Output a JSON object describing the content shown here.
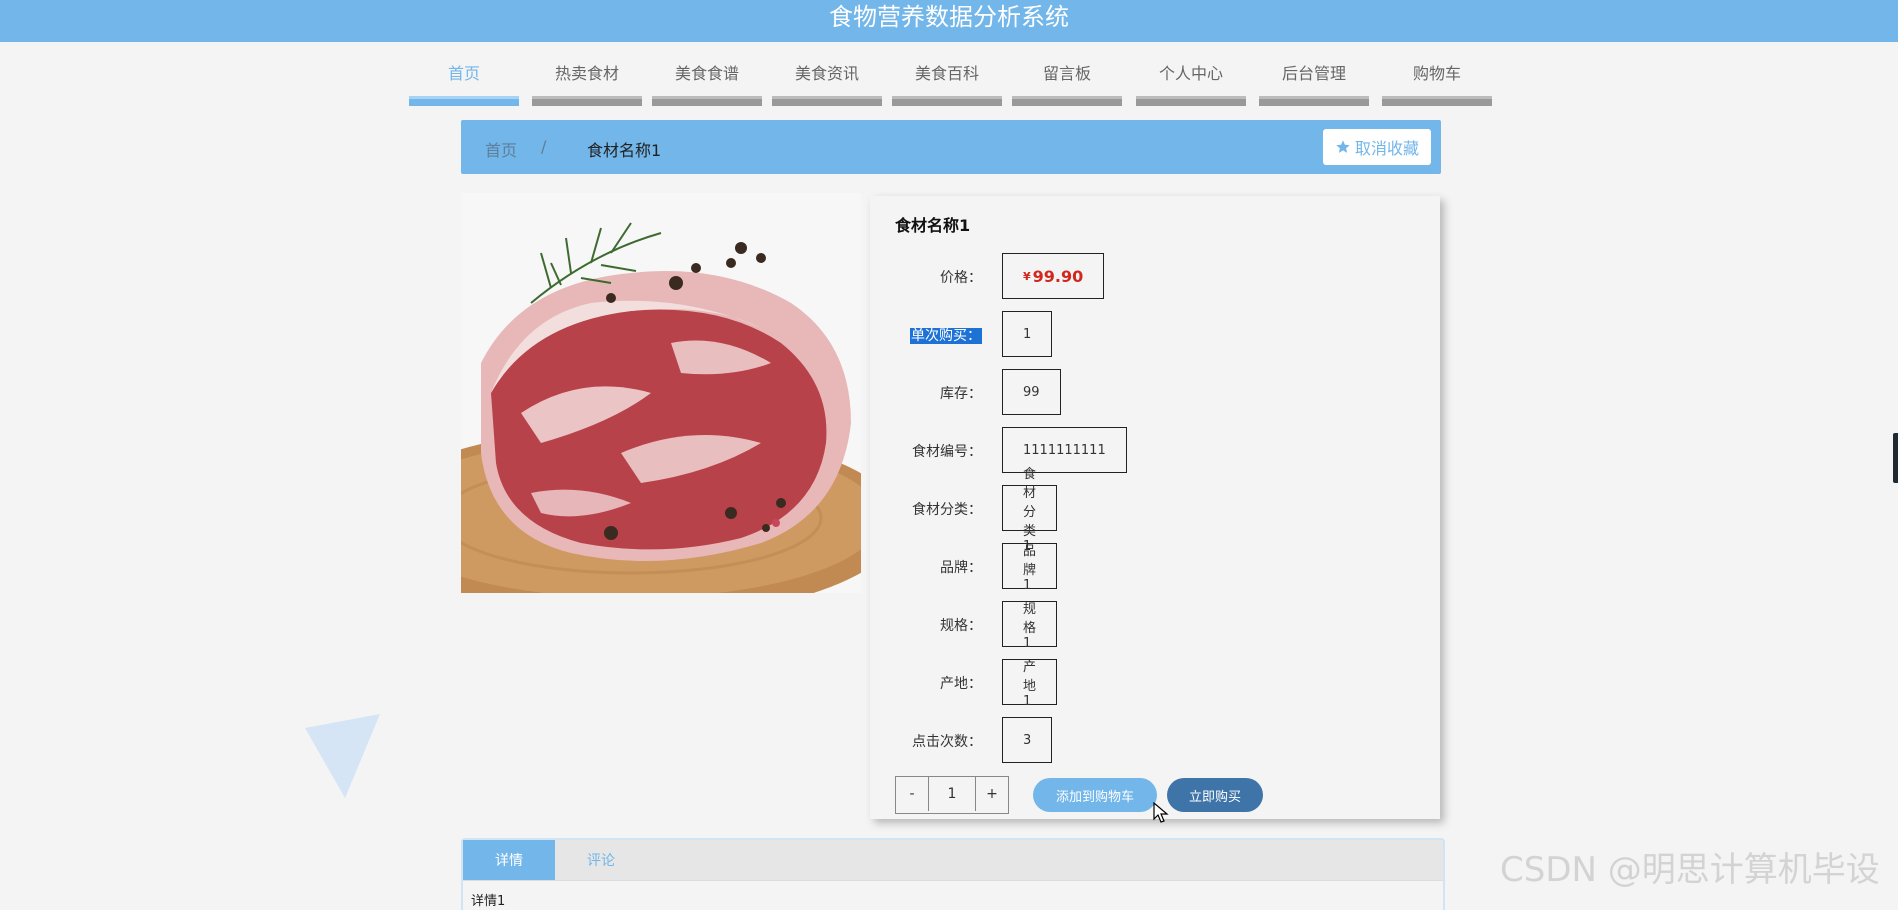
{
  "app": {
    "title": "食物营养数据分析系统"
  },
  "nav": {
    "items": [
      {
        "label": "首页",
        "active": true
      },
      {
        "label": "热卖食材"
      },
      {
        "label": "美食食谱"
      },
      {
        "label": "美食资讯"
      },
      {
        "label": "美食百科"
      },
      {
        "label": "留言板"
      },
      {
        "label": "个人中心"
      },
      {
        "label": "后台管理"
      },
      {
        "label": "购物车"
      }
    ]
  },
  "breadcrumb": {
    "home": "首页",
    "separator": "/",
    "current": "食材名称1"
  },
  "favorite_button": {
    "icon": "star-icon",
    "label": "取消收藏"
  },
  "product": {
    "title": "食材名称1",
    "currency_symbol": "¥",
    "fields": [
      {
        "label": "价格：",
        "value": "99.90"
      },
      {
        "label": "单次购买：",
        "value": "1"
      },
      {
        "label": "库存：",
        "value": "99"
      },
      {
        "label": "食材编号：",
        "value": "1111111111"
      },
      {
        "label": "食材分类：",
        "value": "食材分类1"
      },
      {
        "label": "品牌：",
        "value": "品牌1"
      },
      {
        "label": "规格：",
        "value": "规格1"
      },
      {
        "label": "产地：",
        "value": "产地1"
      },
      {
        "label": "点击次数：",
        "value": "3"
      }
    ]
  },
  "quantity": {
    "minus": "-",
    "value": "1",
    "plus": "+"
  },
  "actions": {
    "add_to_cart": "添加到购物车",
    "buy_now": "立即购买"
  },
  "tabs": [
    {
      "label": "详情",
      "active": true
    },
    {
      "label": "评论"
    }
  ],
  "tab_content": "详情1",
  "watermark": "CSDN @明思计算机毕设",
  "colors": {
    "accent": "#72b6ea",
    "accent_dark": "#3e74a8",
    "price": "#d1271c"
  }
}
